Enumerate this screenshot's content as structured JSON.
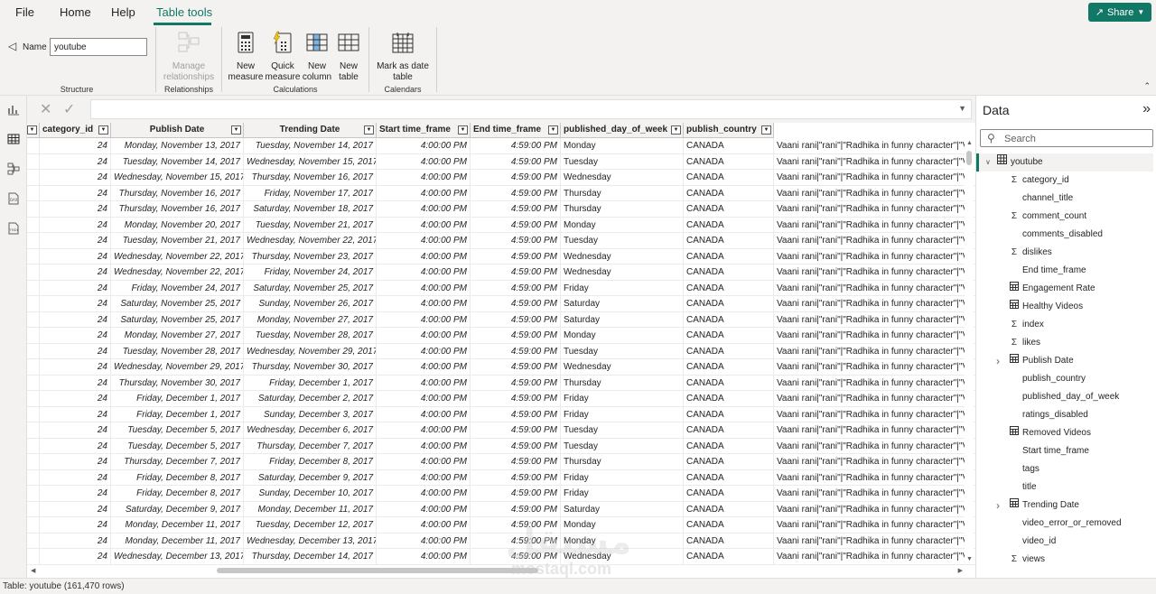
{
  "menu": {
    "tabs": [
      "File",
      "Home",
      "Help",
      "Table tools"
    ],
    "active_tab": "Table tools",
    "share_label": "Share"
  },
  "ribbon": {
    "name_label": "Name",
    "name_value": "youtube",
    "groups": {
      "structure": "Structure",
      "relationships": "Relationships",
      "calculations": "Calculations",
      "calendars": "Calendars"
    },
    "buttons": {
      "manage_relationships": [
        "Manage",
        "relationships"
      ],
      "new_measure": [
        "New",
        "measure"
      ],
      "quick_measure": [
        "Quick",
        "measure"
      ],
      "new_column": [
        "New",
        "column"
      ],
      "new_table": [
        "New",
        "table"
      ],
      "mark_as_date_table": [
        "Mark as date",
        "table"
      ]
    }
  },
  "grid": {
    "columns": [
      "category_id",
      "Publish Date",
      "Trending Date",
      "Start time_frame",
      "End time_frame",
      "published_day_of_week",
      "publish_country"
    ],
    "text_cell": "Vaani rani|\"rani\"|\"Radhika in funny character\"|\"V",
    "rows": [
      [
        "24",
        "Monday, November 13, 2017",
        "Tuesday, November 14, 2017",
        "4:00:00 PM",
        "4:59:00 PM",
        "Monday",
        "CANADA"
      ],
      [
        "24",
        "Tuesday, November 14, 2017",
        "Wednesday, November 15, 2017",
        "4:00:00 PM",
        "4:59:00 PM",
        "Tuesday",
        "CANADA"
      ],
      [
        "24",
        "Wednesday, November 15, 2017",
        "Thursday, November 16, 2017",
        "4:00:00 PM",
        "4:59:00 PM",
        "Wednesday",
        "CANADA"
      ],
      [
        "24",
        "Thursday, November 16, 2017",
        "Friday, November 17, 2017",
        "4:00:00 PM",
        "4:59:00 PM",
        "Thursday",
        "CANADA"
      ],
      [
        "24",
        "Thursday, November 16, 2017",
        "Saturday, November 18, 2017",
        "4:00:00 PM",
        "4:59:00 PM",
        "Thursday",
        "CANADA"
      ],
      [
        "24",
        "Monday, November 20, 2017",
        "Tuesday, November 21, 2017",
        "4:00:00 PM",
        "4:59:00 PM",
        "Monday",
        "CANADA"
      ],
      [
        "24",
        "Tuesday, November 21, 2017",
        "Wednesday, November 22, 2017",
        "4:00:00 PM",
        "4:59:00 PM",
        "Tuesday",
        "CANADA"
      ],
      [
        "24",
        "Wednesday, November 22, 2017",
        "Thursday, November 23, 2017",
        "4:00:00 PM",
        "4:59:00 PM",
        "Wednesday",
        "CANADA"
      ],
      [
        "24",
        "Wednesday, November 22, 2017",
        "Friday, November 24, 2017",
        "4:00:00 PM",
        "4:59:00 PM",
        "Wednesday",
        "CANADA"
      ],
      [
        "24",
        "Friday, November 24, 2017",
        "Saturday, November 25, 2017",
        "4:00:00 PM",
        "4:59:00 PM",
        "Friday",
        "CANADA"
      ],
      [
        "24",
        "Saturday, November 25, 2017",
        "Sunday, November 26, 2017",
        "4:00:00 PM",
        "4:59:00 PM",
        "Saturday",
        "CANADA"
      ],
      [
        "24",
        "Saturday, November 25, 2017",
        "Monday, November 27, 2017",
        "4:00:00 PM",
        "4:59:00 PM",
        "Saturday",
        "CANADA"
      ],
      [
        "24",
        "Monday, November 27, 2017",
        "Tuesday, November 28, 2017",
        "4:00:00 PM",
        "4:59:00 PM",
        "Monday",
        "CANADA"
      ],
      [
        "24",
        "Tuesday, November 28, 2017",
        "Wednesday, November 29, 2017",
        "4:00:00 PM",
        "4:59:00 PM",
        "Tuesday",
        "CANADA"
      ],
      [
        "24",
        "Wednesday, November 29, 2017",
        "Thursday, November 30, 2017",
        "4:00:00 PM",
        "4:59:00 PM",
        "Wednesday",
        "CANADA"
      ],
      [
        "24",
        "Thursday, November 30, 2017",
        "Friday, December 1, 2017",
        "4:00:00 PM",
        "4:59:00 PM",
        "Thursday",
        "CANADA"
      ],
      [
        "24",
        "Friday, December 1, 2017",
        "Saturday, December 2, 2017",
        "4:00:00 PM",
        "4:59:00 PM",
        "Friday",
        "CANADA"
      ],
      [
        "24",
        "Friday, December 1, 2017",
        "Sunday, December 3, 2017",
        "4:00:00 PM",
        "4:59:00 PM",
        "Friday",
        "CANADA"
      ],
      [
        "24",
        "Tuesday, December 5, 2017",
        "Wednesday, December 6, 2017",
        "4:00:00 PM",
        "4:59:00 PM",
        "Tuesday",
        "CANADA"
      ],
      [
        "24",
        "Tuesday, December 5, 2017",
        "Thursday, December 7, 2017",
        "4:00:00 PM",
        "4:59:00 PM",
        "Tuesday",
        "CANADA"
      ],
      [
        "24",
        "Thursday, December 7, 2017",
        "Friday, December 8, 2017",
        "4:00:00 PM",
        "4:59:00 PM",
        "Thursday",
        "CANADA"
      ],
      [
        "24",
        "Friday, December 8, 2017",
        "Saturday, December 9, 2017",
        "4:00:00 PM",
        "4:59:00 PM",
        "Friday",
        "CANADA"
      ],
      [
        "24",
        "Friday, December 8, 2017",
        "Sunday, December 10, 2017",
        "4:00:00 PM",
        "4:59:00 PM",
        "Friday",
        "CANADA"
      ],
      [
        "24",
        "Saturday, December 9, 2017",
        "Monday, December 11, 2017",
        "4:00:00 PM",
        "4:59:00 PM",
        "Saturday",
        "CANADA"
      ],
      [
        "24",
        "Monday, December 11, 2017",
        "Tuesday, December 12, 2017",
        "4:00:00 PM",
        "4:59:00 PM",
        "Monday",
        "CANADA"
      ],
      [
        "24",
        "Monday, December 11, 2017",
        "Wednesday, December 13, 2017",
        "4:00:00 PM",
        "4:59:00 PM",
        "Monday",
        "CANADA"
      ],
      [
        "24",
        "Wednesday, December 13, 2017",
        "Thursday, December 14, 2017",
        "4:00:00 PM",
        "4:59:00 PM",
        "Wednesday",
        "CANADA"
      ]
    ]
  },
  "data_pane": {
    "title": "Data",
    "search_placeholder": "Search",
    "table_name": "youtube",
    "fields": [
      {
        "label": "category_id",
        "icon": "sigma-icon"
      },
      {
        "label": "channel_title",
        "icon": ""
      },
      {
        "label": "comment_count",
        "icon": "sigma-icon"
      },
      {
        "label": "comments_disabled",
        "icon": ""
      },
      {
        "label": "dislikes",
        "icon": "sigma-icon"
      },
      {
        "label": "End time_frame",
        "icon": ""
      },
      {
        "label": "Engagement Rate",
        "icon": "calc-icon"
      },
      {
        "label": "Healthy Videos",
        "icon": "calc-icon"
      },
      {
        "label": "index",
        "icon": "sigma-icon"
      },
      {
        "label": "likes",
        "icon": "sigma-icon"
      },
      {
        "label": "Publish Date",
        "icon": "calendar-icon",
        "expandable": true
      },
      {
        "label": "publish_country",
        "icon": ""
      },
      {
        "label": "published_day_of_week",
        "icon": ""
      },
      {
        "label": "ratings_disabled",
        "icon": ""
      },
      {
        "label": "Removed Videos",
        "icon": "calc-icon"
      },
      {
        "label": "Start time_frame",
        "icon": ""
      },
      {
        "label": "tags",
        "icon": ""
      },
      {
        "label": "title",
        "icon": ""
      },
      {
        "label": "Trending Date",
        "icon": "calendar-icon",
        "expandable": true
      },
      {
        "label": "video_error_or_removed",
        "icon": ""
      },
      {
        "label": "video_id",
        "icon": ""
      },
      {
        "label": "views",
        "icon": "sigma-icon"
      }
    ]
  },
  "status": {
    "text": "Table: youtube (161,470 rows)"
  },
  "watermark": {
    "line1": "مستقل",
    "line2": "mostaql.com"
  },
  "colors": {
    "accent": "#117865"
  }
}
